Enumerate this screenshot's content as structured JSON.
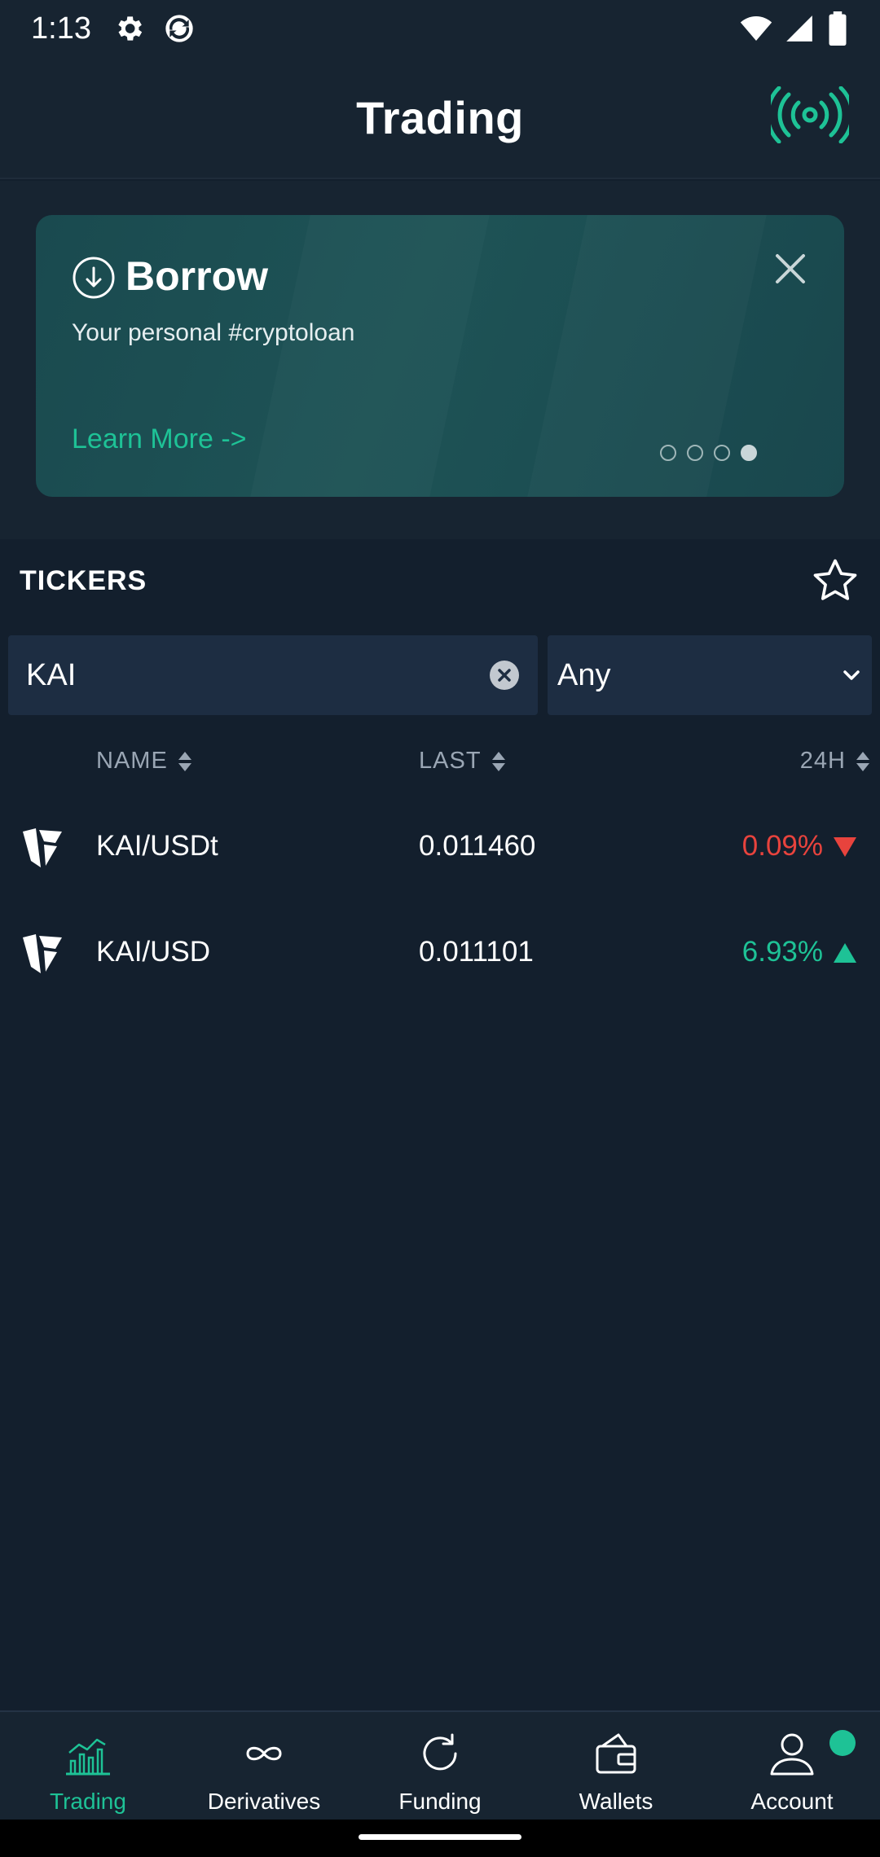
{
  "status_bar": {
    "time": "1:13"
  },
  "header": {
    "title": "Trading"
  },
  "banner": {
    "title": "Borrow",
    "subtitle": "Your personal #cryptoloan",
    "link_label": "Learn More ->",
    "page_count": 4,
    "active_page": 4
  },
  "tickers": {
    "section_label": "TICKERS",
    "search_value": "KAI",
    "quote_filter": "Any",
    "columns": {
      "name": "NAME",
      "last": "LAST",
      "change": "24H"
    },
    "rows": [
      {
        "pair": "KAI/USDt",
        "last": "0.011460",
        "change": "0.09%",
        "direction": "down"
      },
      {
        "pair": "KAI/USD",
        "last": "0.011101",
        "change": "6.93%",
        "direction": "up"
      }
    ]
  },
  "nav": {
    "items": [
      {
        "label": "Trading",
        "icon": "chart-icon",
        "active": true
      },
      {
        "label": "Derivatives",
        "icon": "infinity-icon",
        "active": false
      },
      {
        "label": "Funding",
        "icon": "refresh-icon",
        "active": false
      },
      {
        "label": "Wallets",
        "icon": "wallet-icon",
        "active": false
      },
      {
        "label": "Account",
        "icon": "user-icon",
        "active": false
      }
    ]
  },
  "colors": {
    "accent": "#1ec296",
    "negative": "#e8433d",
    "background": "#131f2d",
    "banner": "#1e5356"
  }
}
